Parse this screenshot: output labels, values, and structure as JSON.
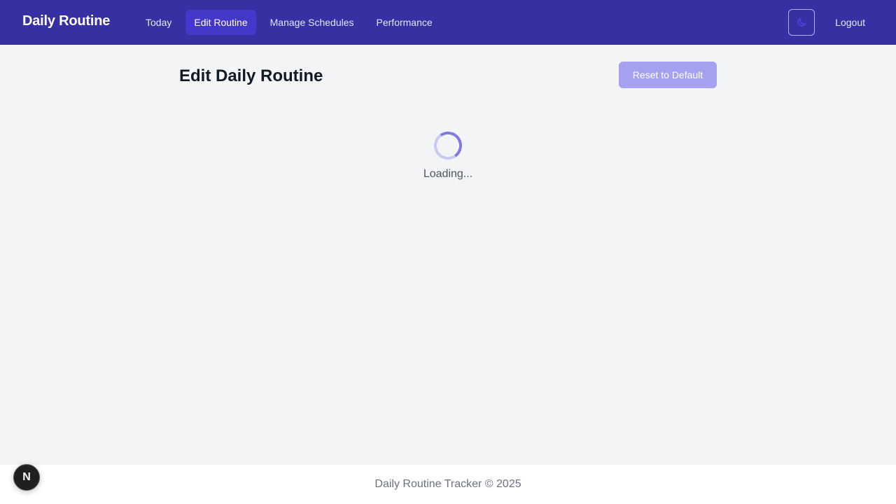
{
  "brand": "Daily Routine",
  "nav": {
    "items": [
      {
        "label": "Today",
        "active": false
      },
      {
        "label": "Edit Routine",
        "active": true
      },
      {
        "label": "Manage Schedules",
        "active": false
      },
      {
        "label": "Performance",
        "active": false
      }
    ]
  },
  "header": {
    "theme_toggle_icon": "moon-icon",
    "logout_label": "Logout"
  },
  "main": {
    "title": "Edit Daily Routine",
    "reset_label": "Reset to Default",
    "loading_text": "Loading..."
  },
  "footer": {
    "text": "Daily Routine Tracker © 2025"
  },
  "dev_badge": {
    "letter": "N",
    "icon": "nextjs-icon"
  },
  "colors": {
    "navbar": "#3730a3",
    "active_nav": "#4338ca",
    "reset_button": "#a5a1ee",
    "spinner_track": "#c7c9f1",
    "spinner_arc": "#7f7ae0",
    "background": "#f3f4f6"
  }
}
